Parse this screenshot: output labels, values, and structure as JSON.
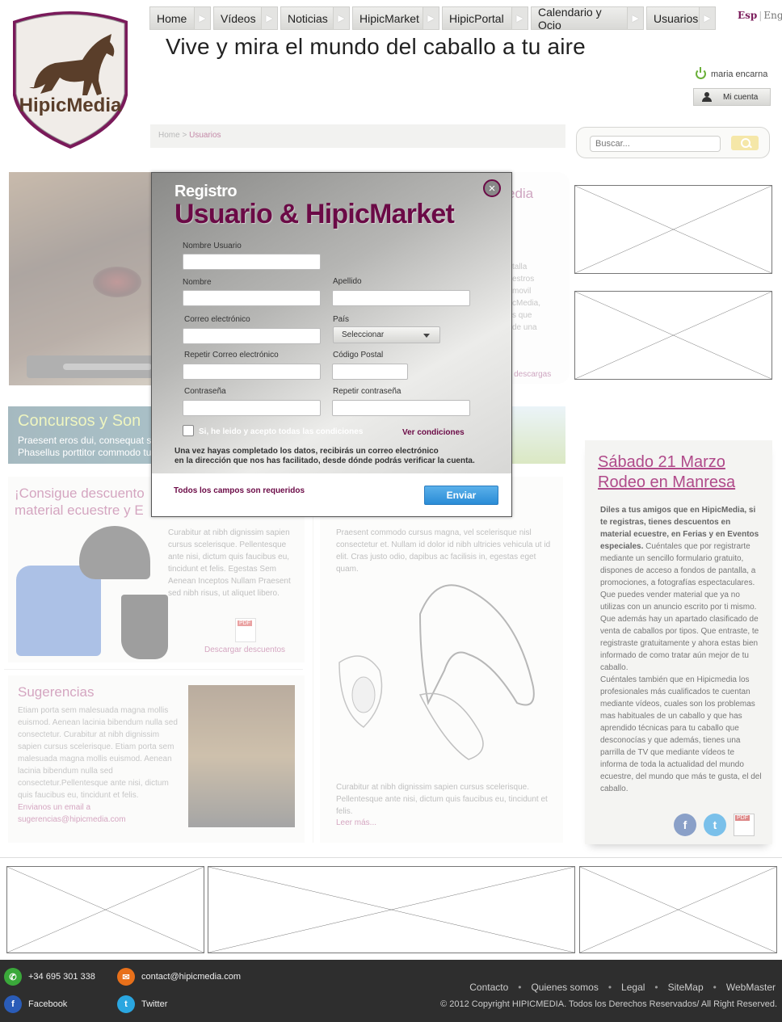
{
  "logo": {
    "text": "HipicMedia"
  },
  "nav": [
    {
      "label": "Home"
    },
    {
      "label": "Vídeos"
    },
    {
      "label": "Noticias"
    },
    {
      "label": "HipicMarket"
    },
    {
      "label": "HipicPortal"
    },
    {
      "label": "Calendario y Ocio"
    },
    {
      "label": "Usuarios"
    }
  ],
  "lang": {
    "active": "Esp",
    "other": "Eng"
  },
  "tagline": "Vive y mira el mundo del caballo a tu aire",
  "user": {
    "name": "maria encarna",
    "account_label": "Mi cuenta"
  },
  "breadcrumb": {
    "home": "Home",
    "separator": ">",
    "current": "Usuarios"
  },
  "search": {
    "placeholder": "Buscar..."
  },
  "app_promo": {
    "title": "edia",
    "text": [
      "talla",
      "estros",
      "movil",
      "",
      "cMedia,",
      "s que",
      "de una"
    ],
    "link": "r descargas"
  },
  "concursos": {
    "title": "Concursos y Son",
    "text1": "Praesent eros dui, consequat s",
    "text2": "Phasellus porttitor commodo tu"
  },
  "descuentos": {
    "title_line1": "¡Consigue descuento",
    "title_line2": "material ecuestre y E",
    "text": "Curabitur at nibh dignissim sapien cursus scelerisque. Pellentesque ante nisi, dictum quis faucibus eu, tincidunt et felis. Egestas Sem Aenean Inceptos Nullam Praesent sed nibh risus, ut aliquet libero.",
    "link": "Descargar descuentos"
  },
  "sugerencias": {
    "title": "Sugerencias",
    "text": "Etiam porta sem malesuada magna mollis euismod. Aenean lacinia bibendum nulla sed consectetur. Curabitur at nibh dignissim sapien cursus scelerisque. Etiam porta sem malesuada magna mollis euismod. Aenean lacinia bibendum nulla sed consectetur.Pellentesque ante nisi, dictum quis faucibus eu, tincidunt et felis.",
    "link1": "Envianos un email a",
    "link2": "sugerencias@hipicmedia.com"
  },
  "middle": {
    "text1": "Praesent commodo cursus magna, vel scelerisque nisl consectetur et. Nullam id dolor id nibh ultricies vehicula ut id elit. Cras justo odio, dapibus ac facilisis in, egestas eget quam.",
    "text2": "Curabitur at nibh dignissim sapien cursus scelerisque. Pellentesque ante nisi, dictum quis faucibus eu, tincidunt et felis.",
    "link": "Leer más..."
  },
  "event": {
    "title_line1": "Sábado 21 Marzo",
    "title_line2": "Rodeo en Manresa",
    "bold_text": "Diles a tus amigos que en HipicMedia, si te registras, tienes descuentos en material ecuestre, en Ferias y en Eventos especiales.",
    "text": " Cuéntales que por registrarte mediante un sencillo formulario gratuito, dispones de acceso a fondos de pantalla, a promociones, a fotografías espectaculares. Que puedes vender material que ya no utilizas con un anuncio escrito por ti mismo. Que además hay un apartado clasificado de venta de caballos por tipos. Que entraste, te registraste gratuitamente y ahora estas bien informado de como tratar aún mejor de tu caballo.",
    "text2": "Cuéntales también que en Hipicmedia los profesionales más cualificados te cuentan mediante vídeos, cuales son los problemas mas habituales de un caballo y que has aprendido técnicas para tu caballo que desconocías y que además, tienes una parrilla de TV que mediante vídeos te informa de toda la actualidad del mundo ecuestre, del mundo que más te gusta, el del caballo.",
    "pdf_label": "PDF"
  },
  "footer": {
    "phone": "+34 695 301 338",
    "email": "contact@hipicmedia.com",
    "facebook": "Facebook",
    "twitter": "Twitter",
    "links": [
      "Contacto",
      "Quienes somos",
      "Legal",
      "SiteMap",
      "WebMaster"
    ],
    "separator": "•",
    "copyright": "© 2012 Copyright HIPICMEDIA. Todos los Derechos Reservados/ All Right Reserved."
  },
  "modal": {
    "subtitle": "Registro",
    "title": "Usuario & HipicMarket",
    "close_icon": "×",
    "fields": {
      "username": "Nombre Usuario",
      "name": "Nombre",
      "surname": "Apellido",
      "email": "Correo electrónico",
      "country": "País",
      "country_value": "Seleccionar",
      "email_repeat": "Repetir Correo electrónico",
      "postal_code": "Código Postal",
      "password": "Contraseña",
      "password_repeat": "Repetir contraseña"
    },
    "accept_label": "Si, he leido y acepto todas las condiciones",
    "conditions_link": "Ver condiciones",
    "info_line1": "Una vez hayas completado los datos, recibirás un correo electrónico",
    "info_line2": "en la dirección que nos has facilitado, desde dónde podrás verificar la cuenta.",
    "required_note": "Todos los campos son requeridos",
    "submit_label": "Enviar"
  },
  "colors": {
    "brand": "#6b0a46",
    "accent_pink": "#b04a8a",
    "footer_bg": "#2e2e2e",
    "submit": "#2a8cd6"
  },
  "icons": [
    "power-icon",
    "user-icon",
    "search-icon",
    "close-icon",
    "chevron-down-icon",
    "pdf-icon",
    "facebook-icon",
    "twitter-icon",
    "phone-icon",
    "mail-icon"
  ]
}
